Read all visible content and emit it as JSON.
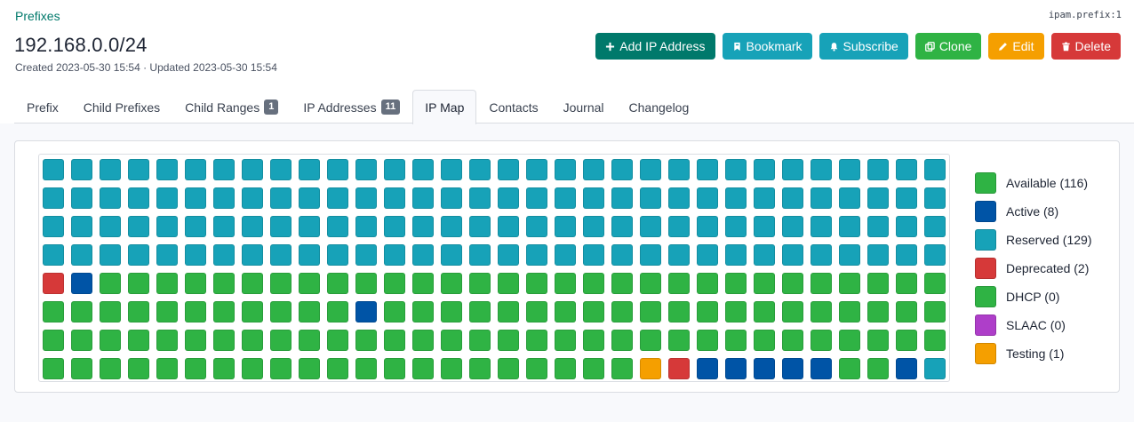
{
  "breadcrumb": "Prefixes",
  "object_id": "ipam.prefix:1",
  "title": "192.168.0.0/24",
  "timestamps": "Created 2023-05-30 15:54 · Updated 2023-05-30 15:54",
  "actions": [
    {
      "name": "add-ip-address-button",
      "icon": "plus-icon",
      "label": "Add IP Address",
      "color": "#00796b"
    },
    {
      "name": "bookmark-button",
      "icon": "bookmark-icon",
      "label": "Bookmark",
      "color": "#17a2b8"
    },
    {
      "name": "subscribe-button",
      "icon": "bell-icon",
      "label": "Subscribe",
      "color": "#17a2b8"
    },
    {
      "name": "clone-button",
      "icon": "copy-icon",
      "label": "Clone",
      "color": "#2fb344"
    },
    {
      "name": "edit-button",
      "icon": "pencil-icon",
      "label": "Edit",
      "color": "#f59f00"
    },
    {
      "name": "delete-button",
      "icon": "trash-icon",
      "label": "Delete",
      "color": "#d63939"
    }
  ],
  "tabs": [
    {
      "label": "Prefix",
      "badge": null,
      "active": false
    },
    {
      "label": "Child Prefixes",
      "badge": null,
      "active": false
    },
    {
      "label": "Child Ranges",
      "badge": "1",
      "active": false
    },
    {
      "label": "IP Addresses",
      "badge": "11",
      "active": false
    },
    {
      "label": "IP Map",
      "badge": null,
      "active": true
    },
    {
      "label": "Contacts",
      "badge": null,
      "active": false
    },
    {
      "label": "Journal",
      "badge": null,
      "active": false
    },
    {
      "label": "Changelog",
      "badge": null,
      "active": false
    }
  ],
  "status_colors": {
    "available": "#2fb344",
    "active": "#0054a6",
    "reserved": "#17a2b8",
    "deprecated": "#d63939",
    "dhcp": "#2fb344",
    "slaac": "#ae3ec9",
    "testing": "#f59f00"
  },
  "ip_map": {
    "columns": 32,
    "rows": [
      "RRRRRRRRRRRRRRRRRRRRRRRRRRRRRRRR",
      "RRRRRRRRRRRRRRRRRRRRRRRRRRRRRRRR",
      "RRRRRRRRRRRRRRRRRRRRRRRRRRRRRRRR",
      "RRRRRRRRRRRRRRRRRRRRRRRRRRRRRRRR",
      "DXAAAAAAAAAAAAAAAAAAAAAAAAAAAAAA",
      "AAAAAAAAAAAXAAAAAAAAAAAAAAAAAAAA",
      "AAAAAAAAAAAAAAAAAAAAAAAAAAAAAAAA",
      "AAAAAAAAAAAAAAAAAAAAATDXXXXXAAXR"
    ],
    "key": {
      "A": "available",
      "X": "active",
      "R": "reserved",
      "D": "deprecated",
      "T": "testing"
    }
  },
  "legend": [
    {
      "status": "available",
      "label": "Available (116)"
    },
    {
      "status": "active",
      "label": "Active (8)"
    },
    {
      "status": "reserved",
      "label": "Reserved (129)"
    },
    {
      "status": "deprecated",
      "label": "Deprecated (2)"
    },
    {
      "status": "dhcp",
      "label": "DHCP (0)"
    },
    {
      "status": "slaac",
      "label": "SLAAC (0)"
    },
    {
      "status": "testing",
      "label": "Testing (1)"
    }
  ]
}
